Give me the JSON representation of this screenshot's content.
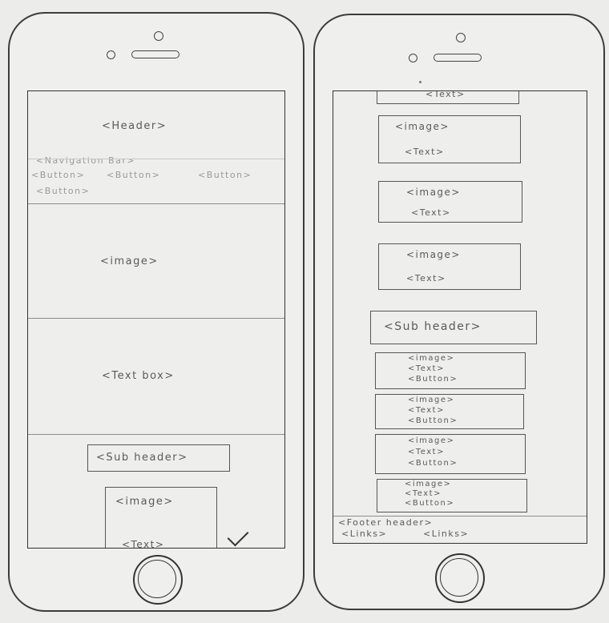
{
  "left_screen": {
    "header": "<Header>",
    "nav_bar": "<Navigation Bar>",
    "button_1": "<Button>",
    "button_2": "<Button>",
    "button_3": "<Button>",
    "button_4": "<Button>",
    "image": "<image>",
    "text_box": "<Text box>",
    "sub_header": "<Sub header>",
    "card_image": "<image>",
    "card_text": "<Text>"
  },
  "right_screen": {
    "top_card_text": "<Text>",
    "cards": [
      {
        "image": "<image>",
        "text": "<Text>"
      },
      {
        "image": "<image>",
        "text": "<Text>"
      },
      {
        "image": "<image>",
        "text": "<Text>"
      }
    ],
    "sub_header": "<Sub header>",
    "list_items": [
      {
        "image": "<image>",
        "text": "<Text>",
        "button": "<Button>"
      },
      {
        "image": "<image>",
        "text": "<Text>",
        "button": "<Button>"
      },
      {
        "image": "<image>",
        "text": "<Text>",
        "button": "<Button>"
      },
      {
        "image": "<image>",
        "text": "<Text>",
        "button": "<Button>"
      }
    ],
    "footer_header": "<Footer header>",
    "footer_link_1": "<Links>",
    "footer_link_2": "<Links>"
  }
}
